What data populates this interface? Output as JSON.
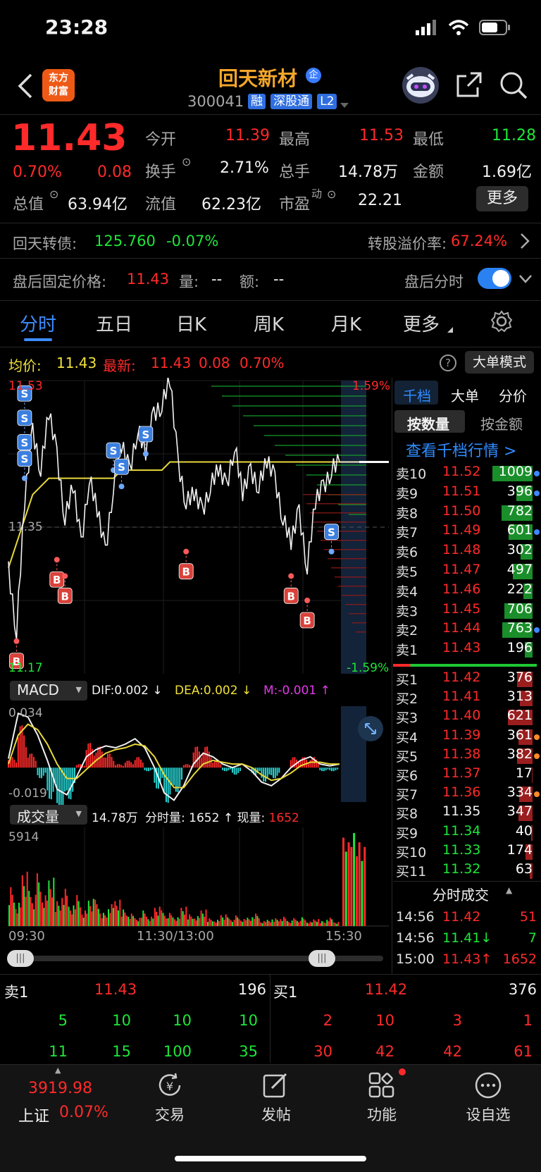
{
  "status_bar": {
    "time": "23:28"
  },
  "header": {
    "logo_line1": "东方",
    "logo_line2": "财富",
    "stock_name": "回天新材",
    "enterprise_badge": "企",
    "code": "300041",
    "badges": [
      "融",
      "深股通",
      "L2"
    ]
  },
  "quote": {
    "price": "11.43",
    "pct": "0.70%",
    "change": "0.08",
    "open_label": "今开",
    "open": "11.39",
    "high_label": "最高",
    "high": "11.53",
    "low_label": "最低",
    "low": "11.28",
    "turnover_label": "换手",
    "turnover": "2.71%",
    "volume_label": "总手",
    "volume": "14.78万",
    "amount_label": "金额",
    "amount": "1.69亿",
    "mcap_label": "总值",
    "mcap": "63.94亿",
    "float_label": "流值",
    "float": "62.23亿",
    "pe_label": "市盈",
    "pe_sup": "动",
    "pe": "22.21",
    "more": "更多"
  },
  "bond": {
    "name": "回天转债:",
    "price": "125.760",
    "pct": "-0.07%",
    "premium_label": "转股溢价率:",
    "premium": "67.24%"
  },
  "after": {
    "fixed_label": "盘后固定价格:",
    "fixed": "11.43",
    "vol_label": "量:",
    "vol": "--",
    "amt_label": "额:",
    "amt": "--",
    "toggle_label": "盘后分时"
  },
  "tabs": [
    "分时",
    "五日",
    "日K",
    "周K",
    "月K",
    "更多"
  ],
  "chart_header": {
    "avg_label": "均价:",
    "avg": "11.43",
    "latest_label": "最新:",
    "latest": "11.43",
    "chg": "0.08",
    "pct": "0.70%",
    "mode": "大单模式"
  },
  "price_axis": {
    "top": "11.53",
    "mid": "11.35",
    "bottom": "11.17",
    "top_pct": "1.59%",
    "bottom_pct": "-1.59%"
  },
  "chart_data": {
    "type": "line",
    "xlabels": [
      "09:30",
      "11:30/13:00",
      "15:30"
    ],
    "ylim": [
      11.17,
      11.53
    ],
    "base": 11.35,
    "price": [
      11.3,
      11.22,
      11.38,
      11.47,
      11.42,
      11.49,
      11.44,
      11.36,
      11.4,
      11.33,
      11.41,
      11.37,
      11.32,
      11.4,
      11.45,
      11.42,
      11.47,
      11.44,
      11.49,
      11.5,
      11.53,
      11.43,
      11.38,
      11.39,
      11.37,
      11.4,
      11.42,
      11.4,
      11.45,
      11.39,
      11.42,
      11.4,
      11.43,
      11.41,
      11.36,
      11.33,
      11.37,
      11.3,
      11.38,
      11.4,
      11.42,
      11.43
    ],
    "avg": [
      11.3,
      11.33,
      11.36,
      11.39,
      11.4,
      11.41,
      11.41,
      11.41,
      11.41,
      11.41,
      11.41,
      11.41,
      11.41,
      11.41,
      11.42,
      11.42,
      11.42,
      11.42,
      11.42,
      11.42,
      11.43,
      11.43,
      11.43,
      11.43,
      11.43,
      11.43,
      11.43,
      11.43,
      11.43,
      11.43,
      11.43,
      11.43,
      11.43,
      11.43,
      11.43,
      11.43,
      11.43,
      11.43,
      11.43,
      11.43,
      11.43,
      11.43
    ]
  },
  "buy_markers": [
    {
      "i": 1,
      "v": 11.21,
      "l": "B"
    },
    {
      "i": 6,
      "v": 11.31,
      "l": "B"
    },
    {
      "i": 7,
      "v": 11.29,
      "l": "B"
    },
    {
      "i": 22,
      "v": 11.32,
      "l": "B"
    },
    {
      "i": 35,
      "v": 11.29,
      "l": "B"
    },
    {
      "i": 37,
      "v": 11.26,
      "l": "B"
    }
  ],
  "sell_markers": [
    {
      "i": 2,
      "v": 11.49,
      "l": "S"
    },
    {
      "i": 2,
      "v": 11.46,
      "l": "S"
    },
    {
      "i": 2,
      "v": 11.43,
      "l": "S"
    },
    {
      "i": 2,
      "v": 11.41,
      "l": "S"
    },
    {
      "i": 13,
      "v": 11.42,
      "l": "S"
    },
    {
      "i": 14,
      "v": 11.4,
      "l": "S"
    },
    {
      "i": 17,
      "v": 11.44,
      "l": "S"
    },
    {
      "i": 40,
      "v": 11.32,
      "l": "S"
    }
  ],
  "macd": {
    "name": "MACD",
    "dif_label": "DIF:",
    "dif": "0.002",
    "dea_label": "DEA:",
    "dea": "0.002",
    "m_label": "M:",
    "m": "-0.001",
    "top": "0.034",
    "bottom": "-0.019",
    "dif_series": [
      0.005,
      0.03,
      0.028,
      0.018,
      0.004,
      -0.012,
      -0.015,
      -0.005,
      0.006,
      0.01,
      0.012,
      0.011,
      0.013,
      0.016,
      0.011,
      0.0,
      -0.014,
      -0.018,
      -0.01,
      0.002,
      0.008,
      0.006,
      0.002,
      0.0,
      0.002,
      -0.002,
      -0.008,
      -0.01,
      -0.006,
      0.0,
      0.004,
      0.006,
      0.002,
      0.001,
      0.002
    ],
    "dea_series": [
      0.002,
      0.018,
      0.024,
      0.021,
      0.013,
      0.002,
      -0.006,
      -0.006,
      -0.001,
      0.004,
      0.008,
      0.01,
      0.011,
      0.013,
      0.012,
      0.006,
      -0.004,
      -0.011,
      -0.011,
      -0.004,
      0.002,
      0.004,
      0.003,
      0.002,
      0.002,
      0.0,
      -0.004,
      -0.007,
      -0.006,
      -0.003,
      0.001,
      0.003,
      0.003,
      0.002,
      0.002
    ]
  },
  "volume": {
    "name": "成交量",
    "total": "14.78万",
    "label_fen": "分时量:",
    "fen": "1652",
    "arrow": "↑",
    "label_now": "现量:",
    "now": "1652",
    "max": "5914",
    "bars": [
      0.5,
      0.3,
      0.7,
      0.4,
      0.6,
      0.35,
      0.55,
      0.3,
      0.45,
      0.25,
      0.4,
      0.2,
      0.35,
      0.3,
      0.15,
      0.25,
      0.3,
      0.2,
      0.15,
      0.1,
      0.2,
      0.12,
      0.25,
      0.18,
      0.15,
      0.1,
      0.22,
      0.14,
      0.12,
      0.2,
      0.1,
      0.08,
      0.15,
      0.1,
      0.12,
      0.08,
      0.1,
      0.15,
      0.06,
      0.08,
      0.1,
      0.12,
      0.07,
      0.09,
      0.1,
      0.05,
      0.08,
      0.06,
      0.1,
      0.05,
      0.95,
      0.8,
      0.9,
      0.85,
      1.0,
      0.75,
      0.9,
      0.7,
      0.85
    ]
  },
  "orderbook": {
    "tabs": [
      "千档",
      "大单",
      "分价"
    ],
    "sub_tabs": [
      "按数量",
      "按金额"
    ],
    "link": "查看千档行情 >",
    "asks": [
      {
        "l": "卖10",
        "p": "11.52",
        "v": "1009",
        "f": 0.95,
        "dot": "#3f86ff"
      },
      {
        "l": "卖9",
        "p": "11.51",
        "v": "396",
        "f": 0.38,
        "dot": "#3f86ff"
      },
      {
        "l": "卖8",
        "p": "11.50",
        "v": "782",
        "f": 0.74,
        "dot": ""
      },
      {
        "l": "卖7",
        "p": "11.49",
        "v": "601",
        "f": 0.57,
        "dot": "#3f86ff"
      },
      {
        "l": "卖6",
        "p": "11.48",
        "v": "302",
        "f": 0.29,
        "dot": ""
      },
      {
        "l": "卖5",
        "p": "11.47",
        "v": "497",
        "f": 0.47,
        "dot": ""
      },
      {
        "l": "卖4",
        "p": "11.46",
        "v": "222",
        "f": 0.21,
        "dot": ""
      },
      {
        "l": "卖3",
        "p": "11.45",
        "v": "706",
        "f": 0.67,
        "dot": ""
      },
      {
        "l": "卖2",
        "p": "11.44",
        "v": "763",
        "f": 0.72,
        "dot": "#3f86ff"
      },
      {
        "l": "卖1",
        "p": "11.43",
        "v": "196",
        "f": 0.19,
        "dot": ""
      }
    ],
    "bids": [
      {
        "l": "买1",
        "p": "11.42",
        "v": "376",
        "f": 0.36,
        "pc": "red",
        "dot": ""
      },
      {
        "l": "买2",
        "p": "11.41",
        "v": "313",
        "f": 0.3,
        "pc": "red",
        "dot": ""
      },
      {
        "l": "买3",
        "p": "11.40",
        "v": "621",
        "f": 0.59,
        "pc": "red",
        "dot": ""
      },
      {
        "l": "买4",
        "p": "11.39",
        "v": "361",
        "f": 0.34,
        "pc": "red",
        "dot": "#ff8a2a"
      },
      {
        "l": "买5",
        "p": "11.38",
        "v": "382",
        "f": 0.36,
        "pc": "red",
        "dot": "#ff8a2a"
      },
      {
        "l": "买6",
        "p": "11.37",
        "v": "17",
        "f": 0.02,
        "pc": "red",
        "dot": ""
      },
      {
        "l": "买7",
        "p": "11.36",
        "v": "334",
        "f": 0.32,
        "pc": "red",
        "dot": "#ff8a2a"
      },
      {
        "l": "买8",
        "p": "11.35",
        "v": "347",
        "f": 0.33,
        "pc": "white",
        "dot": ""
      },
      {
        "l": "买9",
        "p": "11.34",
        "v": "40",
        "f": 0.04,
        "pc": "green",
        "dot": ""
      },
      {
        "l": "买10",
        "p": "11.33",
        "v": "174",
        "f": 0.16,
        "pc": "green",
        "dot": ""
      },
      {
        "l": "买11",
        "p": "11.32",
        "v": "63",
        "f": 0.06,
        "pc": "green",
        "dot": ""
      }
    ],
    "ticks_title": "分时成交",
    "ticks": [
      {
        "t": "14:56",
        "p": "11.42",
        "pc": "red",
        "v": "51",
        "vc": "red"
      },
      {
        "t": "14:56",
        "p": "11.41↓",
        "pc": "green",
        "v": "7",
        "vc": "green"
      },
      {
        "t": "15:00",
        "p": "11.43↑",
        "pc": "red",
        "v": "1652",
        "vc": "red"
      }
    ]
  },
  "bottom_book": {
    "sell_label": "卖1",
    "sell_price": "11.43",
    "sell_vol": "196",
    "buy_label": "买1",
    "buy_price": "11.42",
    "buy_vol": "376",
    "row1_left": [
      "5",
      "10",
      "10",
      "10"
    ],
    "row1_right": [
      "2",
      "10",
      "3",
      "1"
    ],
    "row2_left": [
      "11",
      "15",
      "100",
      "35"
    ],
    "row2_right": [
      "30",
      "42",
      "42",
      "61"
    ]
  },
  "bottom_nav": {
    "index_value": "3919.98",
    "index_name": "上证",
    "index_pct": "0.07%",
    "items": [
      "交易",
      "发帖",
      "功能",
      "设自选"
    ]
  }
}
